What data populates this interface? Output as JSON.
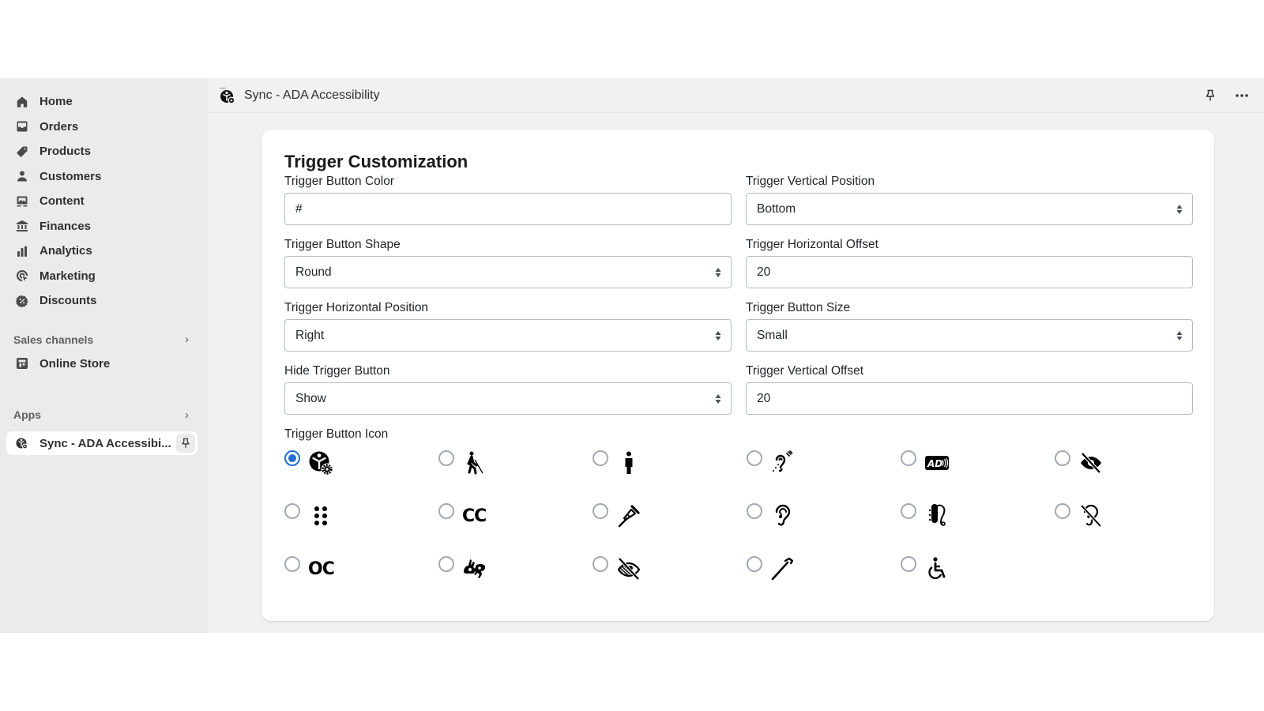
{
  "sidebar": {
    "nav": [
      {
        "label": "Home",
        "icon": "home-icon"
      },
      {
        "label": "Orders",
        "icon": "inbox-icon"
      },
      {
        "label": "Products",
        "icon": "tag-icon"
      },
      {
        "label": "Customers",
        "icon": "person-icon"
      },
      {
        "label": "Content",
        "icon": "image-icon"
      },
      {
        "label": "Finances",
        "icon": "bank-icon"
      },
      {
        "label": "Analytics",
        "icon": "bar-chart-icon"
      },
      {
        "label": "Marketing",
        "icon": "target-icon"
      },
      {
        "label": "Discounts",
        "icon": "discount-icon"
      }
    ],
    "sales_channels": {
      "title": "Sales channels",
      "items": [
        {
          "label": "Online Store",
          "icon": "store-icon"
        }
      ]
    },
    "apps": {
      "title": "Apps",
      "items": [
        {
          "label": "Sync - ADA Accessibi...",
          "icon": "accessibility-gear-icon",
          "active": true
        }
      ]
    }
  },
  "header": {
    "title": "Sync - ADA Accessibility",
    "actions": [
      "pin-icon",
      "more-icon"
    ]
  },
  "card": {
    "title": "Trigger Customization",
    "fields": {
      "button_color": {
        "label": "Trigger Button Color",
        "value": "#",
        "type": "text"
      },
      "vertical_position": {
        "label": "Trigger Vertical Position",
        "value": "Bottom",
        "type": "select"
      },
      "button_shape": {
        "label": "Trigger Button Shape",
        "value": "Round",
        "type": "select"
      },
      "horizontal_offset": {
        "label": "Trigger Horizontal Offset",
        "value": "20",
        "type": "text"
      },
      "horizontal_position": {
        "label": "Trigger Horizontal Position",
        "value": "Right",
        "type": "select"
      },
      "button_size": {
        "label": "Trigger Button Size",
        "value": "Small",
        "type": "select"
      },
      "hide_button": {
        "label": "Hide Trigger Button",
        "value": "Show",
        "type": "select"
      },
      "vertical_offset": {
        "label": "Trigger Vertical Offset",
        "value": "20",
        "type": "text"
      }
    },
    "icon_picker": {
      "label": "Trigger Button Icon",
      "selected": "accessibility-gear",
      "options": [
        "accessibility-gear",
        "blind-person",
        "standing-person",
        "assistive-listening",
        "audio-description",
        "low-vision",
        "braille",
        "closed-captions",
        "crutch",
        "ear",
        "hearing-aid",
        "deaf",
        "open-captions",
        "sign-language",
        "eye-slash",
        "cane",
        "wheelchair"
      ],
      "text_glyphs": {
        "closed-captions": "CC",
        "open-captions": "OC",
        "audio-description": "AD"
      }
    }
  },
  "colors": {
    "sidebar_bg": "#ebebeb",
    "main_bg": "#f1f1f1",
    "accent": "#1f6ed4"
  }
}
